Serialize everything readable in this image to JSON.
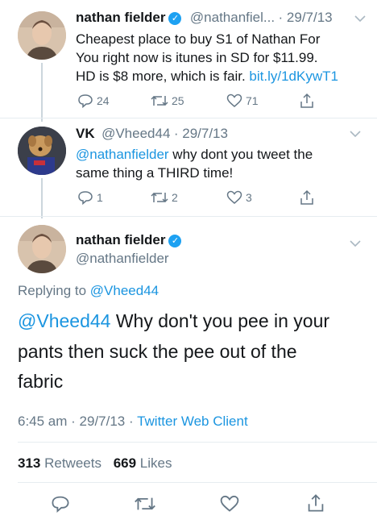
{
  "tweet1": {
    "name": "nathan fielder",
    "handle": "@nathanfiel...",
    "date": "· 29/7/13",
    "line1": "Cheapest place to buy S1 of Nathan For",
    "line2": "You right now is itunes in SD for $11.99.",
    "line3_text": "HD is $8 more, which is fair. ",
    "line3_link": "bit.ly/1dKywT1",
    "replies": "24",
    "retweets": "25",
    "likes": "71"
  },
  "tweet2": {
    "name": "VK",
    "handle": "@Vheed44",
    "date": "· 29/7/13",
    "mention": "@nathanfielder",
    "line1_rest": " why dont you tweet the",
    "line2": "same thing a THIRD time!",
    "replies": "1",
    "retweets": "2",
    "likes": "3"
  },
  "main_tweet": {
    "name": "nathan fielder",
    "handle": "@nathanfielder",
    "replying_prefix": "Replying to ",
    "replying_handle": "@Vheed44",
    "mention": "@Vheed44",
    "line1_rest": " Why don't you pee in your",
    "line2": "pants then suck the pee out of the",
    "line3": "fabric",
    "time_date": "6:45 am · 29/7/13 · ",
    "client": "Twitter Web Client",
    "retweets_count": "313",
    "retweets_label": " Retweets",
    "likes_count": "669",
    "likes_label": " Likes"
  },
  "icons": {
    "reply": "reply-icon",
    "retweet": "retweet-icon",
    "like": "heart-icon",
    "share": "share-icon",
    "verified": "verified-badge-icon",
    "chevron": "chevron-down-icon"
  },
  "colors": {
    "link": "#1b95e0",
    "muted": "#657786",
    "verified": "#1da1f2"
  }
}
